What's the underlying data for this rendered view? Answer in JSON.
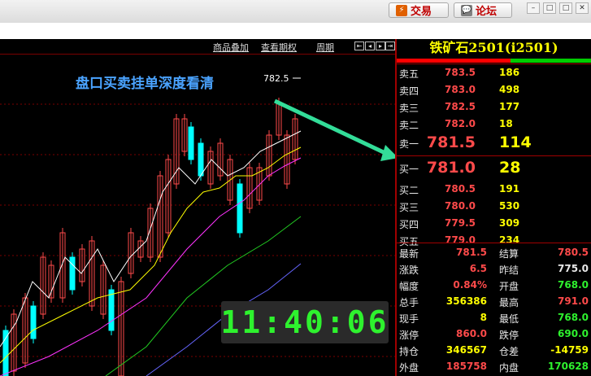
{
  "titlebar": {
    "trade_label": "交易",
    "forum_label": "论坛"
  },
  "toolbar": {
    "links": [
      "商品叠加",
      "查看期权",
      "周期"
    ]
  },
  "chart": {
    "annotation": "盘口买卖挂单深度看清",
    "price_label": "782.5",
    "clock": "11:40:06"
  },
  "quote": {
    "symbol_title": "铁矿石2501(i2501)",
    "asks": [
      {
        "label": "卖五",
        "price": "783.5",
        "vol": "186"
      },
      {
        "label": "卖四",
        "price": "783.0",
        "vol": "498"
      },
      {
        "label": "卖三",
        "price": "782.5",
        "vol": "177"
      },
      {
        "label": "卖二",
        "price": "782.0",
        "vol": "18"
      },
      {
        "label": "卖一",
        "price": "781.5",
        "vol": "114"
      }
    ],
    "bids": [
      {
        "label": "买一",
        "price": "781.0",
        "vol": "28"
      },
      {
        "label": "买二",
        "price": "780.5",
        "vol": "191"
      },
      {
        "label": "买三",
        "price": "780.0",
        "vol": "530"
      },
      {
        "label": "买四",
        "price": "779.5",
        "vol": "309"
      },
      {
        "label": "买五",
        "price": "779.0",
        "vol": "234"
      }
    ],
    "stats": [
      {
        "l1": "最新",
        "v1": "781.5",
        "c1": "#ff4a4a",
        "l2": "结算",
        "v2": "780.5",
        "c2": "#ff4a4a"
      },
      {
        "l1": "涨跌",
        "v1": "6.5",
        "c1": "#ff4a4a",
        "l2": "昨结",
        "v2": "775.0",
        "c2": "#e8e8e8"
      },
      {
        "l1": "幅度",
        "v1": "0.84%",
        "c1": "#ff4a4a",
        "l2": "开盘",
        "v2": "768.0",
        "c2": "#2ef22e"
      },
      {
        "l1": "总手",
        "v1": "356386",
        "c1": "#ffff00",
        "l2": "最高",
        "v2": "791.0",
        "c2": "#ff4a4a"
      },
      {
        "l1": "现手",
        "v1": "8",
        "c1": "#ffff00",
        "l2": "最低",
        "v2": "768.0",
        "c2": "#2ef22e"
      },
      {
        "l1": "涨停",
        "v1": "860.0",
        "c1": "#ff4a4a",
        "l2": "跌停",
        "v2": "690.0",
        "c2": "#2ef22e"
      },
      {
        "l1": "持仓",
        "v1": "346567",
        "c1": "#ffff00",
        "l2": "仓差",
        "v2": "-14759",
        "c2": "#ffff00"
      },
      {
        "l1": "外盘",
        "v1": "185758",
        "c1": "#ff4a4a",
        "l2": "内盘",
        "v2": "170628",
        "c2": "#2ef22e"
      }
    ]
  },
  "colors": {
    "up": "#ff4a4a",
    "down": "#00ffff",
    "volume": "#ffff00",
    "clock": "#2ef22e",
    "annotation": "#4aa3ff"
  }
}
